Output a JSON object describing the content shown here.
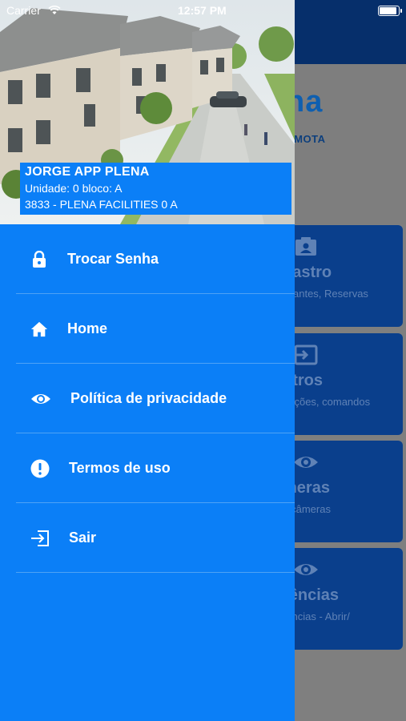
{
  "status_bar": {
    "carrier": "Carrier",
    "time": "12:57 PM",
    "battery_level": 1.0
  },
  "background_app": {
    "logo_fragment": "na",
    "subtitle_fragment": "EMOTA",
    "cards": [
      {
        "title": "dastro",
        "desc": "sitantes, Reservas",
        "icon": "id-card-icon"
      },
      {
        "title": "utros",
        "desc": "dações, comandos",
        "icon": "login-arrow-icon"
      },
      {
        "title": "meras",
        "desc": "s câmeras",
        "icon": "eye-icon"
      },
      {
        "title": "rências",
        "desc": "rências - Abrir/",
        "icon": "eye-icon"
      }
    ]
  },
  "user": {
    "name": "JORGE APP PLENA",
    "unit": "Unidade: 0 bloco: A",
    "condo": "3833 - PLENA FACILITIES 0 A"
  },
  "menu": {
    "items": [
      {
        "label": "Trocar Senha",
        "icon": "lock-icon"
      },
      {
        "label": "Home",
        "icon": "home-icon"
      },
      {
        "label": "Política de privacidade",
        "icon": "eye-icon"
      },
      {
        "label": "Termos de uso",
        "icon": "alert-circle-icon"
      },
      {
        "label": "Sair",
        "icon": "logout-icon"
      }
    ]
  },
  "colors": {
    "drawer": "#0b7ff7",
    "card": "#0a3f8c",
    "topbar": "#062f6b",
    "separator": "#4fa2f5"
  }
}
